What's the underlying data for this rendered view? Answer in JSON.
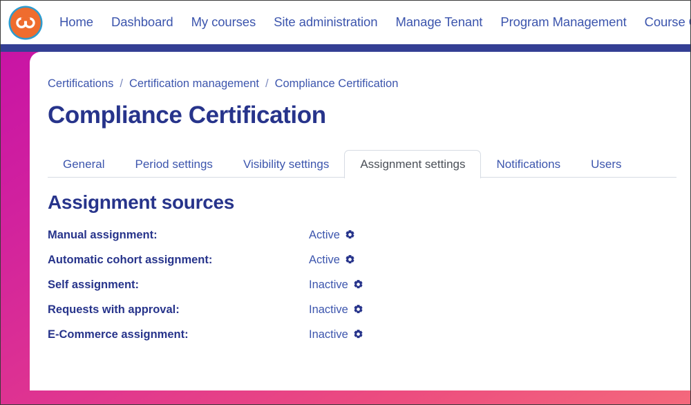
{
  "window": {
    "title": "Compliance Certification"
  },
  "header": {
    "logo_icon": "infinity-loop-logo",
    "nav_items": [
      {
        "label": "Home",
        "name": "nav-home"
      },
      {
        "label": "Dashboard",
        "name": "nav-dashboard"
      },
      {
        "label": "My courses",
        "name": "nav-my-courses"
      },
      {
        "label": "Site administration",
        "name": "nav-site-administration"
      },
      {
        "label": "Manage Tenant",
        "name": "nav-manage-tenant"
      },
      {
        "label": "Program Management",
        "name": "nav-program-management"
      },
      {
        "label": "Course Catalog",
        "name": "nav-course-catalog"
      }
    ]
  },
  "breadcrumb": {
    "separator": "/",
    "items": [
      {
        "label": "Certifications"
      },
      {
        "label": "Certification management"
      },
      {
        "label": "Compliance Certification"
      }
    ]
  },
  "page": {
    "title": "Compliance Certification"
  },
  "tabs": {
    "active": "Assignment settings",
    "items": [
      {
        "label": "General",
        "active": false
      },
      {
        "label": "Period settings",
        "active": false
      },
      {
        "label": "Visibility settings",
        "active": false
      },
      {
        "label": "Assignment settings",
        "active": true
      },
      {
        "label": "Notifications",
        "active": false
      },
      {
        "label": "Users",
        "active": false
      }
    ]
  },
  "assignment_sources": {
    "heading": "Assignment sources",
    "rows": [
      {
        "label": "Manual assignment:",
        "status": "Active",
        "gear_icon": "gear-icon"
      },
      {
        "label": "Automatic cohort assignment:",
        "status": "Active",
        "gear_icon": "gear-icon"
      },
      {
        "label": "Self assignment:",
        "status": "Inactive",
        "gear_icon": "gear-icon"
      },
      {
        "label": "Requests with approval:",
        "status": "Inactive",
        "gear_icon": "gear-icon"
      },
      {
        "label": "E-Commerce assignment:",
        "status": "Inactive",
        "gear_icon": "gear-icon"
      }
    ]
  },
  "colors": {
    "nav_link": "#3c55ad",
    "navy_rule": "#343f94",
    "heading": "#27348b",
    "logo_orange": "#ef6c2e",
    "logo_ring": "#2d9ccf",
    "gradient_start": "#c814a5",
    "gradient_end": "#f4697c",
    "tab_border": "#d6dbe3"
  }
}
